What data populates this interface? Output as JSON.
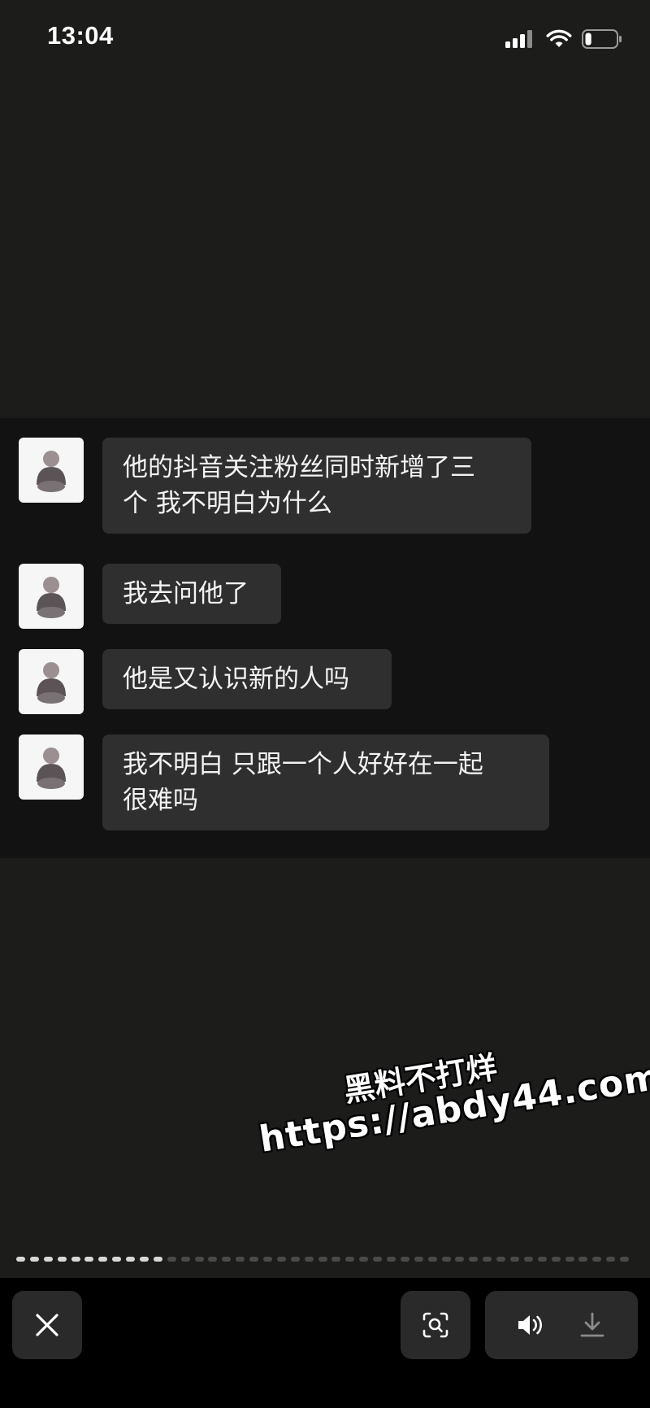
{
  "status_bar": {
    "time": "13:04",
    "icons": [
      "cellular-signal-icon",
      "wifi-icon",
      "battery-icon"
    ],
    "battery_level": 0.2
  },
  "chat": {
    "messages": [
      {
        "sender": "other",
        "avatar": "avatar-icon",
        "lines": [
          "他的抖音关注粉丝同时新增了三",
          "个 我不明白为什么"
        ]
      },
      {
        "sender": "other",
        "avatar": "avatar-icon",
        "lines": [
          "我去问他了"
        ]
      },
      {
        "sender": "other",
        "avatar": "avatar-icon",
        "lines": [
          "他是又认识新的人吗"
        ]
      },
      {
        "sender": "other",
        "avatar": "avatar-icon",
        "lines": [
          "我不明白 只跟一个人好好在一起",
          "很难吗"
        ]
      }
    ]
  },
  "watermark": {
    "line1": "黑料不打烊",
    "line2": "https://abdy44.com"
  },
  "viewer": {
    "total_pages": 45,
    "current_page": 11,
    "buttons": {
      "close": "close-icon",
      "scan": "scan-search-icon",
      "volume": "volume-icon",
      "download": "download-icon"
    }
  },
  "colors": {
    "background": "#1c1c1b",
    "chat_panel": "#121212",
    "bubble": "#2f2f2f",
    "text": "#f3f3f3",
    "bottom_bar": "#000000"
  }
}
